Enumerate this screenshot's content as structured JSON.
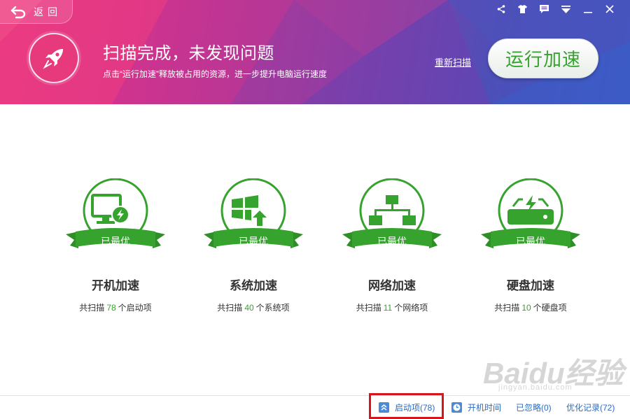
{
  "header": {
    "back_label": "返回",
    "headline": "扫描完成，未发现问题",
    "subline": "点击“运行加速”释放被占用的资源，进一步提升电脑运行速度",
    "rescan_label": "重新扫描",
    "run_button_label": "运行加速"
  },
  "window_icons": [
    "share-icon",
    "shirt-skin-icon",
    "message-icon",
    "dropdown-menu-icon",
    "minimize-icon",
    "close-icon"
  ],
  "cards": [
    {
      "icon": "monitor-bolt-icon",
      "badge": "已最优",
      "title": "开机加速",
      "prefix": "共扫描",
      "count": "78",
      "suffix": "个启动项"
    },
    {
      "icon": "windows-upgrade-icon",
      "badge": "已最优",
      "title": "系统加速",
      "prefix": "共扫描",
      "count": "40",
      "suffix": "个系统项"
    },
    {
      "icon": "network-topology-icon",
      "badge": "已最优",
      "title": "网络加速",
      "prefix": "共扫描",
      "count": "11",
      "suffix": "个网络项"
    },
    {
      "icon": "disk-bolt-icon",
      "badge": "已最优",
      "title": "硬盘加速",
      "prefix": "共扫描",
      "count": "10",
      "suffix": "个硬盘项"
    }
  ],
  "footer": {
    "startup_items": "启动项(78)",
    "boot_time": "开机时间",
    "ignored": "已忽略(0)",
    "history": "优化记录(72)"
  },
  "watermark": {
    "logo": "Baidu经验",
    "url": "jingyan.baidu.com"
  },
  "colors": {
    "accent_green": "#36a32e",
    "link_blue": "#2a6cc2",
    "highlight_red": "#d9151c",
    "banner_pink": "#e83a86",
    "banner_blue": "#3a5bc4"
  }
}
